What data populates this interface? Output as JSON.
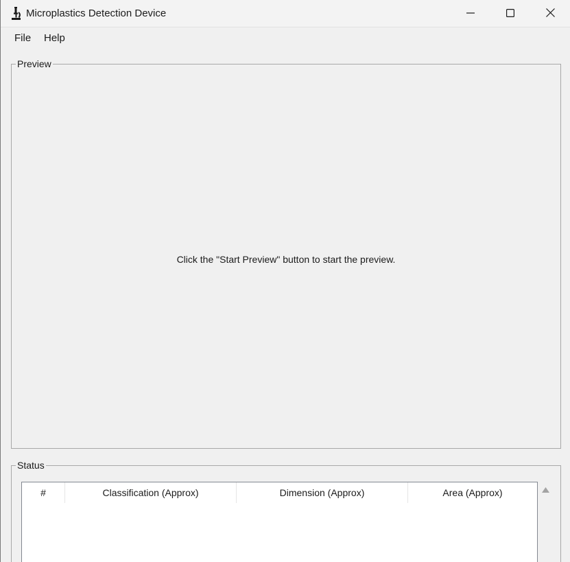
{
  "window": {
    "title": "Microplastics Detection Device",
    "app_icon": "microscope-icon",
    "controls": {
      "minimize_icon": "minimize-icon",
      "maximize_icon": "maximize-icon",
      "close_icon": "close-icon"
    }
  },
  "menubar": {
    "items": [
      {
        "label": "File"
      },
      {
        "label": "Help"
      }
    ]
  },
  "preview": {
    "title": "Preview",
    "message": "Click the \"Start Preview\" button to start the preview."
  },
  "status": {
    "title": "Status",
    "table": {
      "columns": [
        "#",
        "Classification (Approx)",
        "Dimension (Approx)",
        "Area (Approx)"
      ],
      "rows": []
    },
    "scrollbar": {
      "up_icon": "scroll-up-arrow-icon"
    }
  }
}
